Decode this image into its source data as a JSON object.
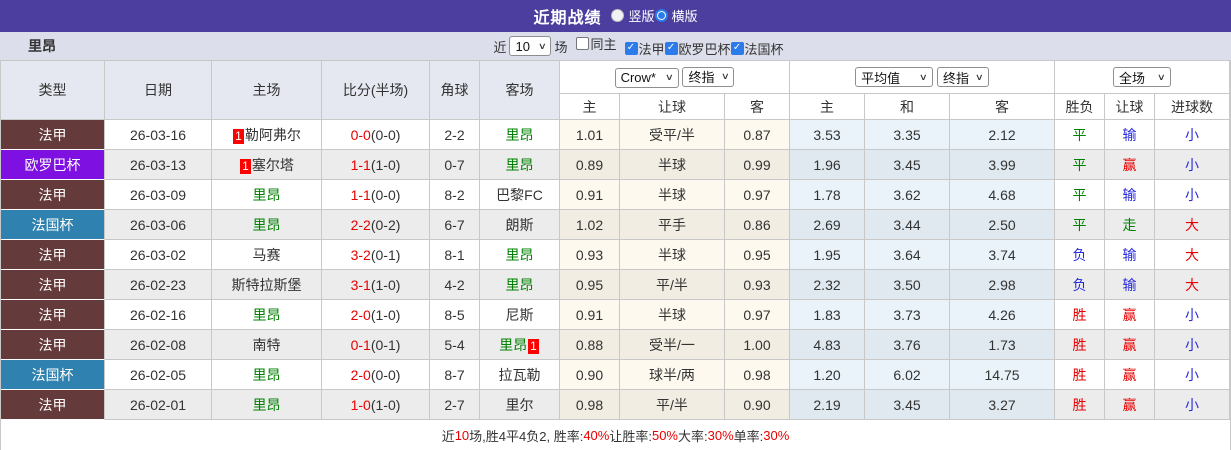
{
  "title_bar": {
    "title": "近期战绩",
    "radios": [
      {
        "key": "vertical",
        "label": "竖版",
        "selected": false
      },
      {
        "key": "horizontal",
        "label": "横版",
        "selected": true
      }
    ]
  },
  "filter_bar": {
    "team": "里昂",
    "near_label": "近",
    "games_select": "10",
    "games_suffix": "场",
    "same_home": {
      "label": "同主",
      "checked": false
    },
    "league_filters": [
      {
        "label": "法甲",
        "checked": true
      },
      {
        "label": "欧罗巴杯",
        "checked": true
      },
      {
        "label": "法国杯",
        "checked": true
      }
    ]
  },
  "table": {
    "static_headers": [
      "类型",
      "日期",
      "主场",
      "比分(半场)",
      "角球",
      "客场"
    ],
    "selects": [
      "Crow*",
      "终指",
      "平均值",
      "终指",
      "全场"
    ],
    "sub_headers": [
      "主",
      "让球",
      "客",
      "主",
      "和",
      "客",
      "胜负",
      "让球",
      "进球数"
    ],
    "rows": [
      {
        "type": "法甲",
        "date": "26-03-16",
        "home": {
          "name": "勒阿弗尔",
          "badge_before": "1"
        },
        "score_ft": "0-0",
        "score_ht": "(0-0)",
        "corner": "2-2",
        "away": {
          "name": "里昂",
          "self": true
        },
        "odds": [
          "1.01",
          "受平/半",
          "0.87"
        ],
        "avg": [
          "3.53",
          "3.35",
          "2.12"
        ],
        "results": [
          {
            "t": "平",
            "c": "green"
          },
          {
            "t": "输",
            "c": "blue"
          },
          {
            "t": "小",
            "c": "blue"
          }
        ]
      },
      {
        "type": "欧罗巴杯",
        "date": "26-03-13",
        "home": {
          "name": "塞尔塔",
          "badge_before": "1"
        },
        "score_ft": "1-1",
        "score_ht": "(1-0)",
        "corner": "0-7",
        "away": {
          "name": "里昂",
          "self": true
        },
        "odds": [
          "0.89",
          "半球",
          "0.99"
        ],
        "avg": [
          "1.96",
          "3.45",
          "3.99"
        ],
        "results": [
          {
            "t": "平",
            "c": "green"
          },
          {
            "t": "赢",
            "c": "red"
          },
          {
            "t": "小",
            "c": "blue"
          }
        ]
      },
      {
        "type": "法甲",
        "date": "26-03-09",
        "home": {
          "name": "里昂",
          "self": true
        },
        "score_ft": "1-1",
        "score_ht": "(0-0)",
        "corner": "8-2",
        "away": {
          "name": "巴黎FC"
        },
        "odds": [
          "0.91",
          "半球",
          "0.97"
        ],
        "avg": [
          "1.78",
          "3.62",
          "4.68"
        ],
        "results": [
          {
            "t": "平",
            "c": "green"
          },
          {
            "t": "输",
            "c": "blue"
          },
          {
            "t": "小",
            "c": "blue"
          }
        ]
      },
      {
        "type": "法国杯",
        "date": "26-03-06",
        "home": {
          "name": "里昂",
          "self": true
        },
        "score_ft": "2-2",
        "score_ht": "(0-2)",
        "corner": "6-7",
        "away": {
          "name": "朗斯"
        },
        "odds": [
          "1.02",
          "平手",
          "0.86"
        ],
        "avg": [
          "2.69",
          "3.44",
          "2.50"
        ],
        "results": [
          {
            "t": "平",
            "c": "green"
          },
          {
            "t": "走",
            "c": "green"
          },
          {
            "t": "大",
            "c": "red"
          }
        ]
      },
      {
        "type": "法甲",
        "date": "26-03-02",
        "home": {
          "name": "马赛"
        },
        "score_ft": "3-2",
        "score_ht": "(0-1)",
        "corner": "8-1",
        "away": {
          "name": "里昂",
          "self": true
        },
        "odds": [
          "0.93",
          "半球",
          "0.95"
        ],
        "avg": [
          "1.95",
          "3.64",
          "3.74"
        ],
        "results": [
          {
            "t": "负",
            "c": "blue"
          },
          {
            "t": "输",
            "c": "blue"
          },
          {
            "t": "大",
            "c": "red"
          }
        ]
      },
      {
        "type": "法甲",
        "date": "26-02-23",
        "home": {
          "name": "斯特拉斯堡"
        },
        "score_ft": "3-1",
        "score_ht": "(1-0)",
        "corner": "4-2",
        "away": {
          "name": "里昂",
          "self": true
        },
        "odds": [
          "0.95",
          "平/半",
          "0.93"
        ],
        "avg": [
          "2.32",
          "3.50",
          "2.98"
        ],
        "results": [
          {
            "t": "负",
            "c": "blue"
          },
          {
            "t": "输",
            "c": "blue"
          },
          {
            "t": "大",
            "c": "red"
          }
        ]
      },
      {
        "type": "法甲",
        "date": "26-02-16",
        "home": {
          "name": "里昂",
          "self": true
        },
        "score_ft": "2-0",
        "score_ht": "(1-0)",
        "corner": "8-5",
        "away": {
          "name": "尼斯"
        },
        "odds": [
          "0.91",
          "半球",
          "0.97"
        ],
        "avg": [
          "1.83",
          "3.73",
          "4.26"
        ],
        "results": [
          {
            "t": "胜",
            "c": "red"
          },
          {
            "t": "赢",
            "c": "red"
          },
          {
            "t": "小",
            "c": "blue"
          }
        ]
      },
      {
        "type": "法甲",
        "date": "26-02-08",
        "home": {
          "name": "南特"
        },
        "score_ft": "0-1",
        "score_ht": "(0-1)",
        "corner": "5-4",
        "away": {
          "name": "里昂",
          "self": true,
          "badge_after": "1"
        },
        "odds": [
          "0.88",
          "受半/一",
          "1.00"
        ],
        "avg": [
          "4.83",
          "3.76",
          "1.73"
        ],
        "results": [
          {
            "t": "胜",
            "c": "red"
          },
          {
            "t": "赢",
            "c": "red"
          },
          {
            "t": "小",
            "c": "blue"
          }
        ]
      },
      {
        "type": "法国杯",
        "date": "26-02-05",
        "home": {
          "name": "里昂",
          "self": true
        },
        "score_ft": "2-0",
        "score_ht": "(0-0)",
        "corner": "8-7",
        "away": {
          "name": "拉瓦勒"
        },
        "odds": [
          "0.90",
          "球半/两",
          "0.98"
        ],
        "avg": [
          "1.20",
          "6.02",
          "14.75"
        ],
        "results": [
          {
            "t": "胜",
            "c": "red"
          },
          {
            "t": "赢",
            "c": "red"
          },
          {
            "t": "小",
            "c": "blue"
          }
        ]
      },
      {
        "type": "法甲",
        "date": "26-02-01",
        "home": {
          "name": "里昂",
          "self": true
        },
        "score_ft": "1-0",
        "score_ht": "(1-0)",
        "corner": "2-7",
        "away": {
          "name": "里尔"
        },
        "odds": [
          "0.98",
          "平/半",
          "0.90"
        ],
        "avg": [
          "2.19",
          "3.45",
          "3.27"
        ],
        "results": [
          {
            "t": "胜",
            "c": "red"
          },
          {
            "t": "赢",
            "c": "red"
          },
          {
            "t": "小",
            "c": "blue"
          }
        ]
      }
    ]
  },
  "footer": {
    "segments": [
      {
        "t": "近"
      },
      {
        "t": "10",
        "red": true
      },
      {
        "t": "场,胜4平4负2, 胜率:"
      },
      {
        "t": "40%",
        "red": true
      },
      {
        "t": " 让胜率:"
      },
      {
        "t": "50%",
        "red": true
      },
      {
        "t": " 大率:"
      },
      {
        "t": "30%",
        "red": true
      },
      {
        "t": " 单率:"
      },
      {
        "t": "30%",
        "red": true
      }
    ]
  },
  "colors": {
    "accent_purple": "#4b3e9e",
    "filter_bg": "#dcdeeb",
    "header_bg": "#e6e8f1",
    "check_blue": "#2b7bea",
    "badge_red": "#ff0000",
    "league": {
      "法甲": "#643a3b",
      "欧罗巴杯": "#7e10e2",
      "法国杯": "#2f81af"
    },
    "result": {
      "green": "#008000",
      "blue": "#2929dd",
      "red": "#e80000"
    }
  }
}
